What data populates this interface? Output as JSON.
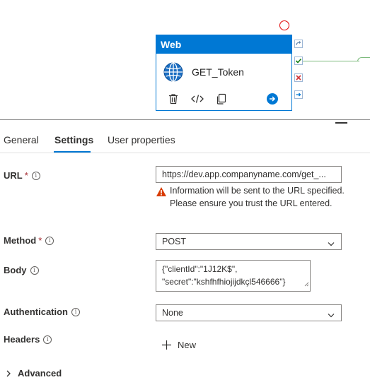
{
  "activity": {
    "type_label": "Web",
    "name": "GET_Token"
  },
  "tabs": [
    {
      "label": "General"
    },
    {
      "label": "Settings"
    },
    {
      "label": "User properties"
    }
  ],
  "form": {
    "url": {
      "label": "URL",
      "required_mark": "*",
      "value": "https://dev.app.companyname.com/get_...",
      "warning": "Information will be sent to the URL specified. Please ensure you trust the URL entered."
    },
    "method": {
      "label": "Method",
      "required_mark": "*",
      "value": "POST"
    },
    "body": {
      "label": "Body",
      "line1": "{\"clientId\":\"1J12K$\",",
      "line2": "\"secret\":\"kshfhfhiojijdkçl546666\"}"
    },
    "authentication": {
      "label": "Authentication",
      "value": "None"
    },
    "headers": {
      "label": "Headers",
      "new_label": "New"
    },
    "advanced": {
      "label": "Advanced"
    }
  },
  "colors": {
    "accent": "#0078d4",
    "success": "#107c10",
    "error": "#d13438",
    "warning": "#d83b01"
  }
}
